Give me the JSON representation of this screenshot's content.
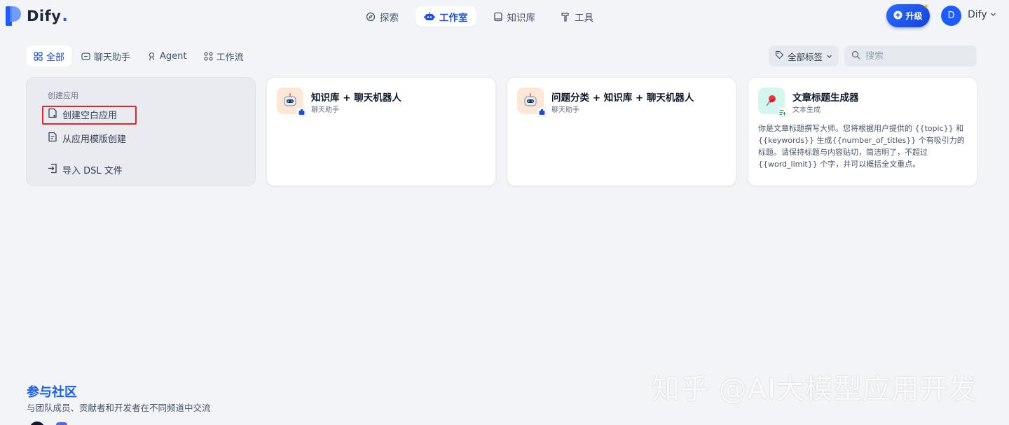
{
  "brand": {
    "name": "Dify",
    "suffix": "."
  },
  "nav": [
    {
      "label": "探索",
      "icon": "compass-icon"
    },
    {
      "label": "工作室",
      "icon": "robot-icon",
      "active": true
    },
    {
      "label": "知识库",
      "icon": "book-icon"
    },
    {
      "label": "工具",
      "icon": "hammer-icon"
    }
  ],
  "header": {
    "upgrade_label": "升级",
    "avatar_initial": "D",
    "user_name": "Dify"
  },
  "filters": {
    "tabs": [
      {
        "label": "全部",
        "icon": "grid-icon",
        "active": true
      },
      {
        "label": "聊天助手",
        "icon": "chat-icon"
      },
      {
        "label": "Agent",
        "icon": "agent-icon"
      },
      {
        "label": "工作流",
        "icon": "workflow-icon"
      }
    ],
    "tag_label": "全部标签",
    "search_placeholder": "搜索"
  },
  "create": {
    "heading": "创建应用",
    "items": [
      {
        "label": "创建空白应用",
        "icon": "file-plus-icon"
      },
      {
        "label": "从应用模版创建",
        "icon": "file-template-icon"
      },
      {
        "label": "导入 DSL 文件",
        "icon": "import-icon"
      }
    ]
  },
  "apps": [
    {
      "title": "知识库 + 聊天机器人",
      "type": "聊天助手",
      "description": "",
      "icon": "robot-icon"
    },
    {
      "title": "问题分类 + 知识库 + 聊天机器人",
      "type": "聊天助手",
      "description": "",
      "icon": "robot-icon"
    },
    {
      "title": "文章标题生成器",
      "type": "文本生成",
      "description": "你是文章标题撰写大师。您将根据用户提供的 {{topic}} 和 {{keywords}} 生成{{number_of_titles}} 个有吸引力的标题。请保持标题与内容贴切，简洁明了，不超过 {{word_limit}} 个字，并可以概括全文重点。",
      "icon": "pushpin-icon"
    }
  ],
  "community": {
    "title": "参与社区",
    "subtitle": "与团队成员、贡献者和开发者在不同频道中交流"
  },
  "watermark": "知乎 @AI大模型应用开发",
  "colors": {
    "accent": "#155eef",
    "background": "#f2f4f7",
    "highlight_box": "#e0262a"
  }
}
